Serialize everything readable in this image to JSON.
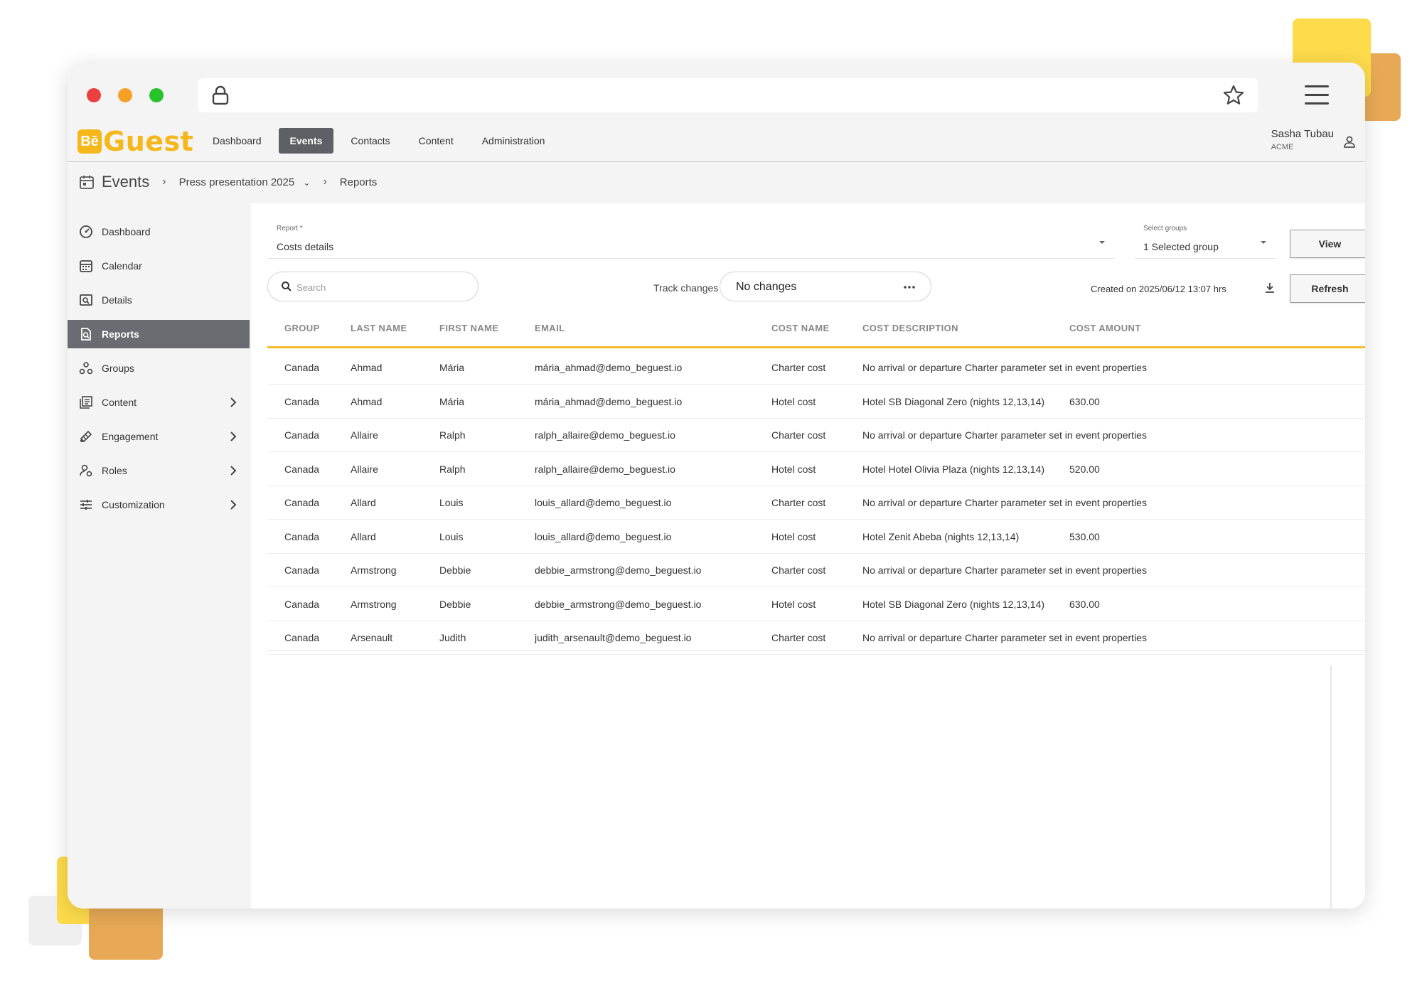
{
  "browser": {
    "address": ""
  },
  "app": {
    "logo_mark": "Bē",
    "logo_text": "Guest",
    "nav": [
      {
        "label": "Dashboard"
      },
      {
        "label": "Events"
      },
      {
        "label": "Contacts"
      },
      {
        "label": "Content"
      },
      {
        "label": "Administration"
      }
    ],
    "active_nav": "Events",
    "user": {
      "name": "Sasha Tubau",
      "org": "ACME"
    }
  },
  "breadcrumb": {
    "title": "Events",
    "event": "Press presentation 2025",
    "page": "Reports"
  },
  "sidebar": {
    "items": [
      {
        "label": "Dashboard",
        "icon": "dashboard-icon"
      },
      {
        "label": "Calendar",
        "icon": "calendar-icon"
      },
      {
        "label": "Details",
        "icon": "details-icon"
      },
      {
        "label": "Reports",
        "icon": "reports-icon"
      },
      {
        "label": "Groups",
        "icon": "groups-icon"
      },
      {
        "label": "Content",
        "icon": "content-icon"
      },
      {
        "label": "Engagement",
        "icon": "engagement-icon"
      },
      {
        "label": "Roles",
        "icon": "roles-icon"
      },
      {
        "label": "Customization",
        "icon": "customization-icon"
      }
    ],
    "active": "Reports"
  },
  "report": {
    "report_label": "Report *",
    "report_value": "Costs details",
    "groups_label": "Select groups",
    "groups_value": "1 Selected group",
    "view_label": "View",
    "search_placeholder": "Search",
    "track_label": "Track changes",
    "track_value": "No changes",
    "created": "Created on 2025/06/12 13:07 hrs",
    "refresh_label": "Refresh"
  },
  "table": {
    "columns": [
      "GROUP",
      "LAST NAME",
      "FIRST NAME",
      "EMAIL",
      "COST NAME",
      "COST DESCRIPTION",
      "COST AMOUNT"
    ],
    "rows": [
      [
        "Canada",
        "Ahmad",
        "Mária",
        "mária_ahmad@demo_beguest.io",
        "Charter cost",
        "No arrival or departure Charter parameter set in event properties",
        ""
      ],
      [
        "Canada",
        "Ahmad",
        "Mária",
        "mária_ahmad@demo_beguest.io",
        "Hotel cost",
        "Hotel SB Diagonal Zero (nights 12,13,14)",
        "630.00"
      ],
      [
        "Canada",
        "Allaire",
        "Ralph",
        "ralph_allaire@demo_beguest.io",
        "Charter cost",
        "No arrival or departure Charter parameter set in event properties",
        ""
      ],
      [
        "Canada",
        "Allaire",
        "Ralph",
        "ralph_allaire@demo_beguest.io",
        "Hotel cost",
        "Hotel Hotel Olivia Plaza (nights 12,13,14)",
        "520.00"
      ],
      [
        "Canada",
        "Allard",
        "Louis",
        "louis_allard@demo_beguest.io",
        "Charter cost",
        "No arrival or departure Charter parameter set in event properties",
        ""
      ],
      [
        "Canada",
        "Allard",
        "Louis",
        "louis_allard@demo_beguest.io",
        "Hotel cost",
        "Hotel Zenit Abeba (nights 12,13,14)",
        "530.00"
      ],
      [
        "Canada",
        "Armstrong",
        "Debbie",
        "debbie_armstrong@demo_beguest.io",
        "Charter cost",
        "No arrival or departure Charter parameter set in event properties",
        ""
      ],
      [
        "Canada",
        "Armstrong",
        "Debbie",
        "debbie_armstrong@demo_beguest.io",
        "Hotel cost",
        "Hotel SB Diagonal Zero (nights 12,13,14)",
        "630.00"
      ],
      [
        "Canada",
        "Arsenault",
        "Judith",
        "judith_arsenault@demo_beguest.io",
        "Charter cost",
        "No arrival or departure Charter parameter set in event properties",
        ""
      ]
    ]
  },
  "colors": {
    "accent": "#f6b71a",
    "active_nav": "#5f5f66",
    "table_underline": "#f4bd2a"
  }
}
